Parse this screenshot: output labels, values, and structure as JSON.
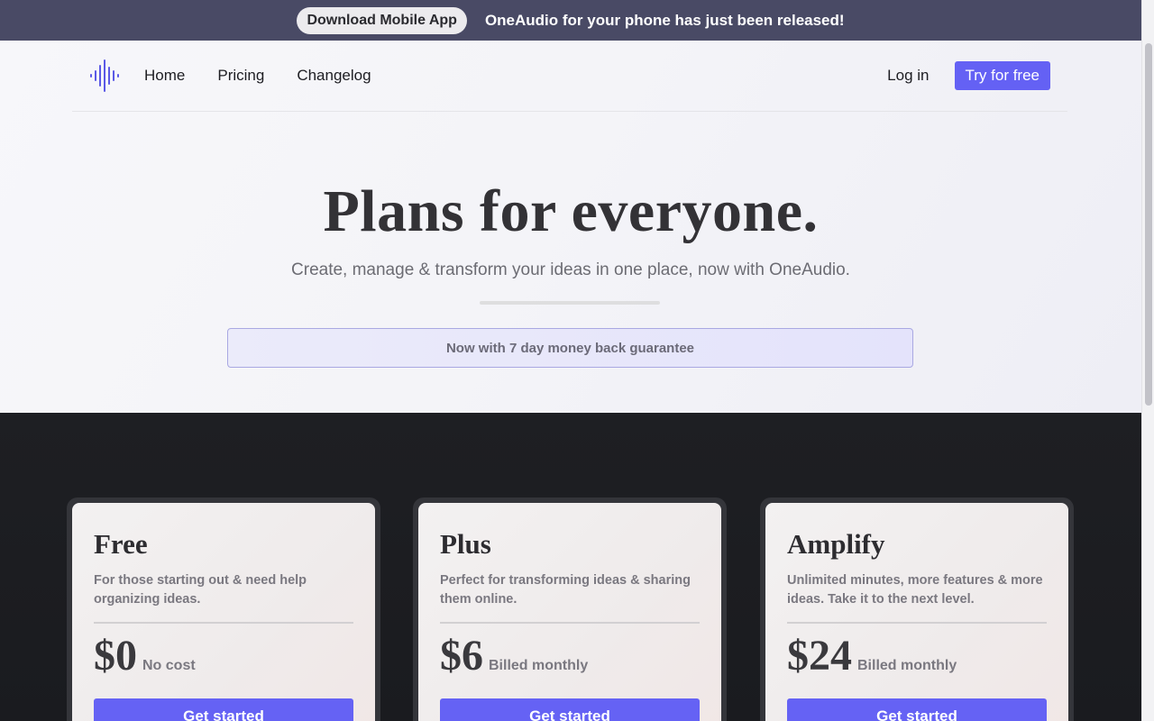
{
  "announcement": {
    "button_label": "Download Mobile App",
    "message": "OneAudio for your phone has just been released!"
  },
  "nav": {
    "logo_icon": "soundwave-icon",
    "links": [
      {
        "label": "Home"
      },
      {
        "label": "Pricing"
      },
      {
        "label": "Changelog"
      }
    ],
    "login_label": "Log in",
    "try_label": "Try for free"
  },
  "hero": {
    "title": "Plans for everyone.",
    "subtitle": "Create, manage & transform your ideas in one place, now with OneAudio.",
    "guarantee": "Now with 7 day money back guarantee"
  },
  "plans": [
    {
      "name": "Free",
      "description": "For those starting out & need help organizing ideas.",
      "price": "$0",
      "note": "No cost",
      "cta": "Get started"
    },
    {
      "name": "Plus",
      "description": "Perfect for transforming ideas & sharing them online.",
      "price": "$6",
      "note": "Billed monthly",
      "cta": "Get started"
    },
    {
      "name": "Amplify",
      "description": "Unlimited minutes, more features & more ideas. Take it to the next level.",
      "price": "$24",
      "note": "Billed monthly",
      "cta": "Get started"
    }
  ],
  "colors": {
    "accent": "#6461f4",
    "banner": "#494a65",
    "dark_section": "#1c1d21"
  }
}
